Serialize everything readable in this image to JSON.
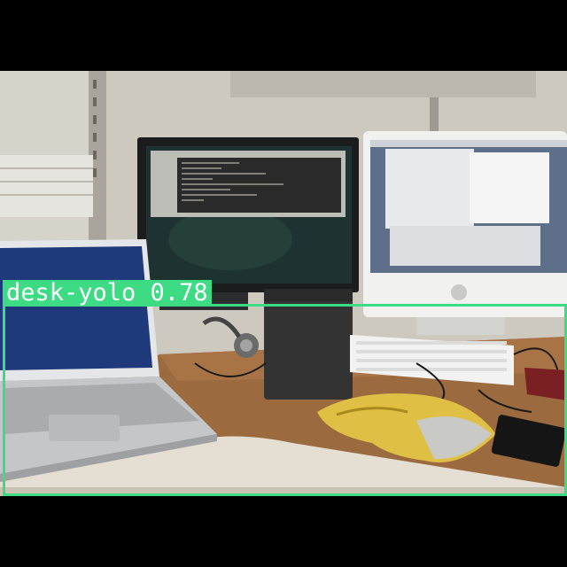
{
  "detection": {
    "label": "desk-yolo 0.78",
    "class_name": "desk-yolo",
    "confidence": 0.78,
    "box_color": "#3ddc84"
  },
  "scene_objects": [
    "laptop",
    "desktop-monitor",
    "imac",
    "keyboard",
    "speaker",
    "headphones",
    "chip-bag",
    "power-adapter"
  ]
}
